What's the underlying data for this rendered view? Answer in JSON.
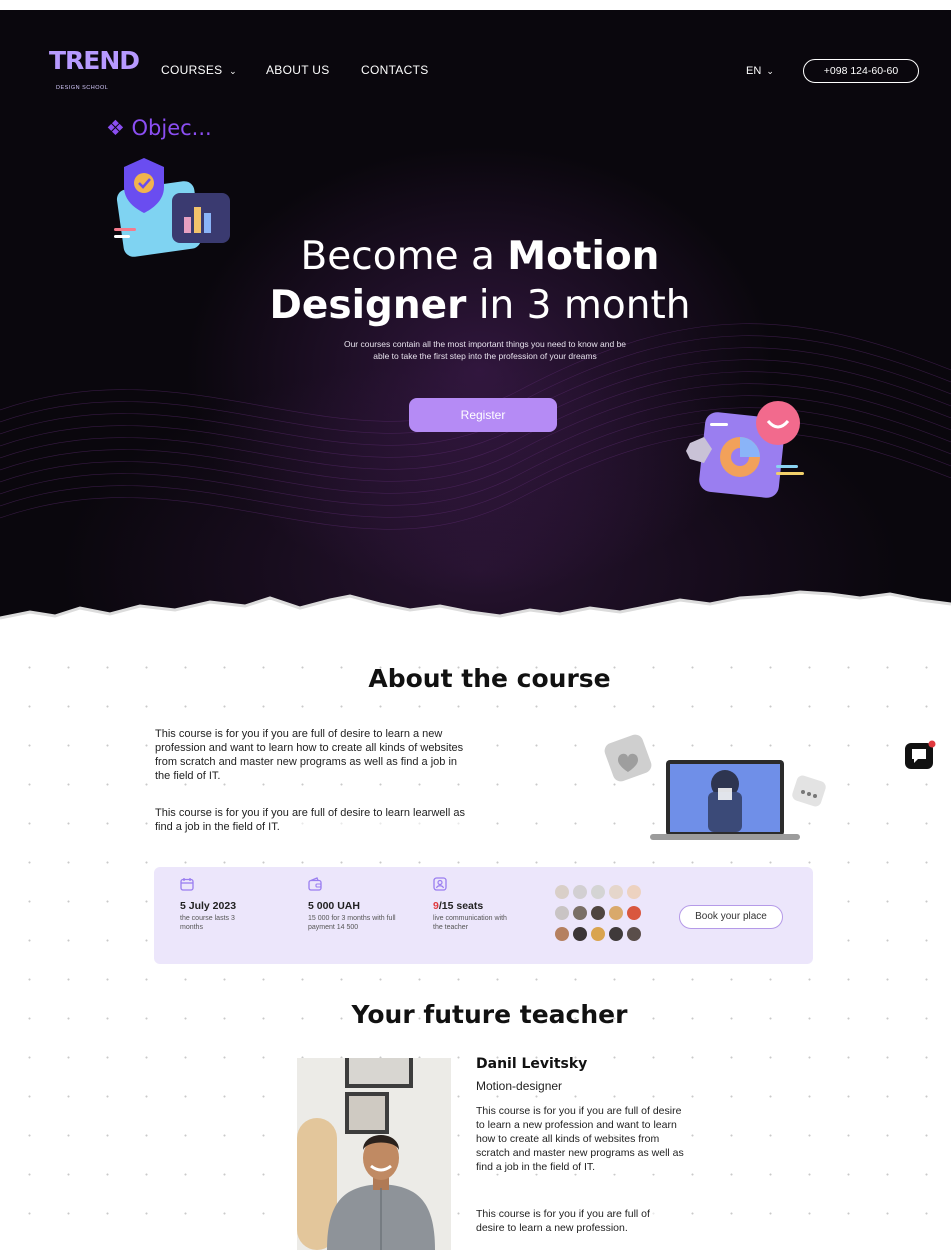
{
  "header": {
    "logo_text": "TREND",
    "logo_sub": "DESIGN SCHOOL",
    "nav": {
      "courses": "COURSES",
      "about": "ABOUT US",
      "contacts": "CONTACTS"
    },
    "language": "EN",
    "phone": "+098 124-60-60"
  },
  "hero": {
    "object_label": "Objec...",
    "title_part1": "Become a ",
    "title_bold1": "Motion",
    "title_bold2": "Designer",
    "title_part2": " in 3 month",
    "subtitle": "Our courses contain all the most important things you need to know and be able to take the first step into the profession of your dreams",
    "register_label": "Register"
  },
  "about": {
    "title": "About the course",
    "paragraph1": "This course is for you if you are full of desire to learn a new profession and want to learn how to create all kinds of websites from scratch and master new programs as well as find a job in the field of IT.",
    "paragraph2": "This course is for you if you are full of desire to learn learwell as find a job in the field of IT."
  },
  "info": {
    "date": "5 July 2023",
    "date_note": "the course lasts 3 months",
    "price": "5 000 UAH",
    "price_note": "15 000 for 3 months with full payment 14 500",
    "seats_taken": "9",
    "seats_total": "/15 seats",
    "seats_note": "live communication with the teacher",
    "book_label": "Book your place"
  },
  "teacher": {
    "section_title": "Your future teacher",
    "name": "Danil Levitsky",
    "role": "Motion-designer",
    "bio1": "This course is for you if you are full of desire to learn a new profession and want to learn how to create all kinds of websites from scratch and master new programs as well as find a job in the field of IT.",
    "bio2": "This course is for you if you are full of desire to learn a new profession."
  },
  "colors": {
    "accent": "#b58bf5",
    "hero_bg": "#0a070d",
    "info_bg": "#ece6fb",
    "seats_highlight": "#e0393e"
  },
  "icons": [
    "chevron-down-icon",
    "calendar-icon",
    "wallet-icon",
    "user-icon",
    "chat-icon"
  ]
}
